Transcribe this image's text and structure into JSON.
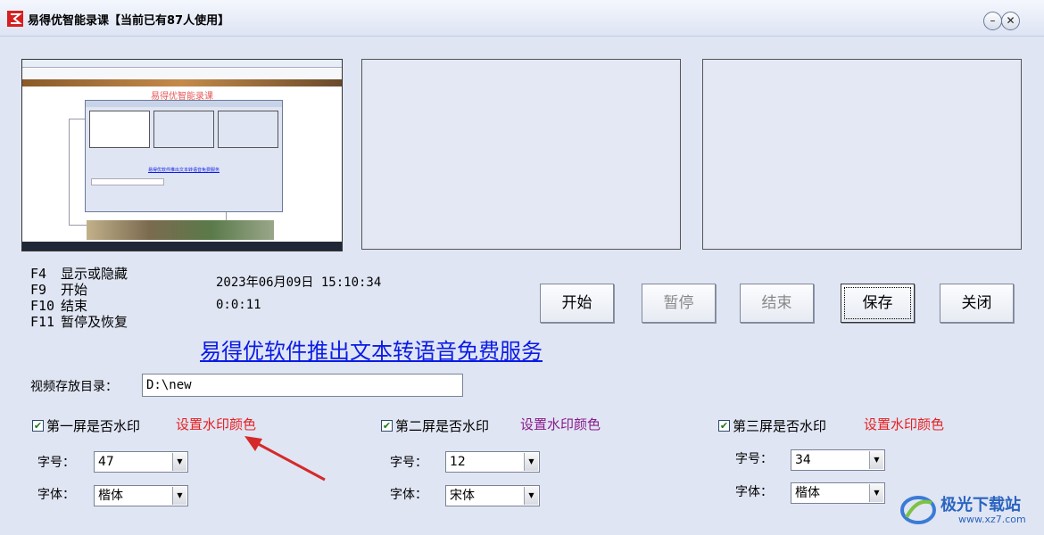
{
  "window": {
    "title": "易得优智能录课【当前已有87人使用】"
  },
  "preview": {
    "heading": "易得优智能录课",
    "inner_link": "易得优软件推出文本转语音免费服务"
  },
  "hotkeys": [
    {
      "key": "F4",
      "desc": "显示或隐藏"
    },
    {
      "key": "F9",
      "desc": "开始"
    },
    {
      "key": "F10",
      "desc": "结束"
    },
    {
      "key": "F11",
      "desc": "暂停及恢复"
    }
  ],
  "status": {
    "datetime": "2023年06月09日 15:10:34",
    "elapsed": "0:0:11"
  },
  "buttons": {
    "start": "开始",
    "pause": "暂停",
    "stop": "结束",
    "save": "保存",
    "close": "关闭"
  },
  "promo_link": "易得优软件推出文本转语音免费服务",
  "save_dir": {
    "label": "视频存放目录：",
    "value": "D:\\new"
  },
  "screens": [
    {
      "checkbox": "第一屏是否水印",
      "watermark_color_label": "设置水印颜色",
      "watermark_color": "#e81f1f",
      "size_label": "字号：",
      "size": "47",
      "font_label": "字体：",
      "font": "楷体"
    },
    {
      "checkbox": "第二屏是否水印",
      "watermark_color_label": "设置水印颜色",
      "watermark_color": "#8a1a8a",
      "size_label": "字号：",
      "size": "12",
      "font_label": "字体：",
      "font": "宋体"
    },
    {
      "checkbox": "第三屏是否水印",
      "watermark_color_label": "设置水印颜色",
      "watermark_color": "#e81f1f",
      "size_label": "字号：",
      "size": "34",
      "font_label": "字体：",
      "font": "楷体"
    }
  ],
  "watermark_logo": {
    "name": "极光下载站",
    "url": "www.xz7.com"
  },
  "colors": {
    "link": "#0b1be6",
    "arrow": "#d42a2a",
    "background": "#dfe5f3"
  }
}
